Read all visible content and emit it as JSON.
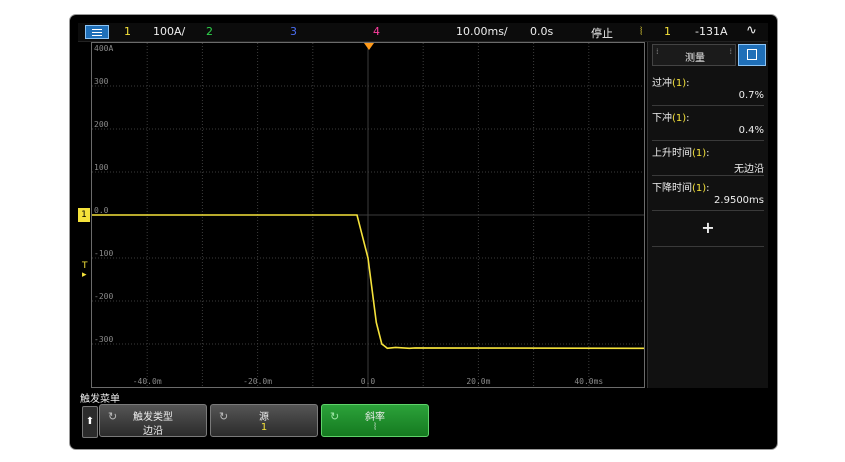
{
  "topbar": {
    "ch1_num": "1",
    "ch1_scale": "100A/",
    "ch2_num": "2",
    "ch3_num": "3",
    "ch4_num": "4",
    "timebase": "10.00ms/",
    "delay": "0.0s",
    "run_state": "停止",
    "trigger_slope_icon": "falling-edge-icon",
    "trigger_slope_symbol": "⦚",
    "trigger_source": "1",
    "trigger_level": "-131A",
    "wave_icon_symbol": "∿"
  },
  "colors": {
    "ch1": "#f5e23b",
    "ch2": "#2fd34b",
    "ch3": "#4a6df0",
    "ch4": "#ff3fa0",
    "trigger_marker": "#ff9a1a",
    "grid": "#3c3c3c",
    "softkey_active": "#1f8f2b",
    "panel_accent": "#1f6fb8"
  },
  "y_axis_labels": [
    "400A",
    "300",
    "200",
    "100",
    "0.0",
    "-100",
    "-200",
    "-300"
  ],
  "x_axis_labels": [
    "-40.0m",
    "-20.0m",
    "0.0",
    "20.0m",
    "40.0ms"
  ],
  "ch1_marker": "1",
  "measurements": {
    "tab_label": "测量",
    "items": [
      {
        "label": "过冲",
        "source": "(1)",
        "colon": ":",
        "value": "0.7%"
      },
      {
        "label": "下冲",
        "source": "(1)",
        "colon": ":",
        "value": "0.4%"
      },
      {
        "label": "上升时间",
        "source": "(1)",
        "colon": ":",
        "value": "无边沿"
      },
      {
        "label": "下降时间",
        "source": "(1)",
        "colon": ":",
        "value": "2.9500ms"
      }
    ],
    "add_symbol": "+"
  },
  "softkeys": {
    "menu_title": "触发菜单",
    "back_symbol": "⬆",
    "buttons": [
      {
        "line1": "触发类型",
        "line2": "边沿",
        "has_knob": true
      },
      {
        "line1": "源",
        "line2": "1",
        "has_knob": true
      },
      {
        "line1": "斜率",
        "line2": "⦚",
        "has_knob": true
      }
    ],
    "knob_symbol": "↻"
  },
  "chart_data": {
    "type": "line",
    "title": "",
    "xlabel": "",
    "ylabel": "",
    "xlim": [
      -50,
      50
    ],
    "ylim": [
      -400,
      400
    ],
    "x_unit": "ms",
    "y_unit": "A",
    "grid": true,
    "series": [
      {
        "x": [
          -50,
          -2,
          0,
          1.5,
          2.5,
          3,
          3.5,
          5,
          7.5,
          8.5,
          50
        ],
        "y": [
          0,
          0,
          -100,
          -250,
          -300,
          -305,
          -310,
          -308,
          -310,
          -309,
          -310
        ]
      }
    ]
  }
}
